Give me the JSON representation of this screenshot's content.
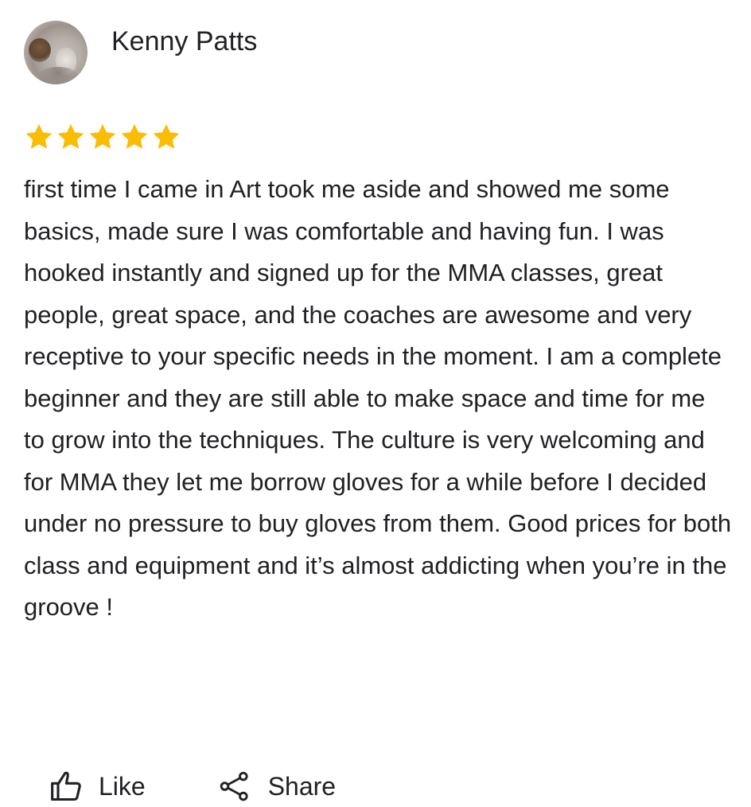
{
  "review": {
    "reviewer_name": "Kenny Patts",
    "rating": 5,
    "rating_max": 5,
    "star_color": "#FBBC04",
    "text": "first time I came in Art took me aside and showed me some basics, made sure I was comfortable and having fun. I was hooked instantly and signed up for the MMA classes, great people, great space, and the coaches are awesome and very receptive to your specific needs in the moment. I am a complete beginner and they are still able to make space and time for me to grow into the techniques. The culture is very welcoming and for MMA they let me borrow gloves for a while before I decided under no pressure to buy gloves from them. Good prices for both class and equipment and it’s almost addicting when you’re in the groove !"
  },
  "actions": {
    "like_label": "Like",
    "like_icon": "thumbs-up-icon",
    "share_label": "Share",
    "share_icon": "share-icon"
  }
}
